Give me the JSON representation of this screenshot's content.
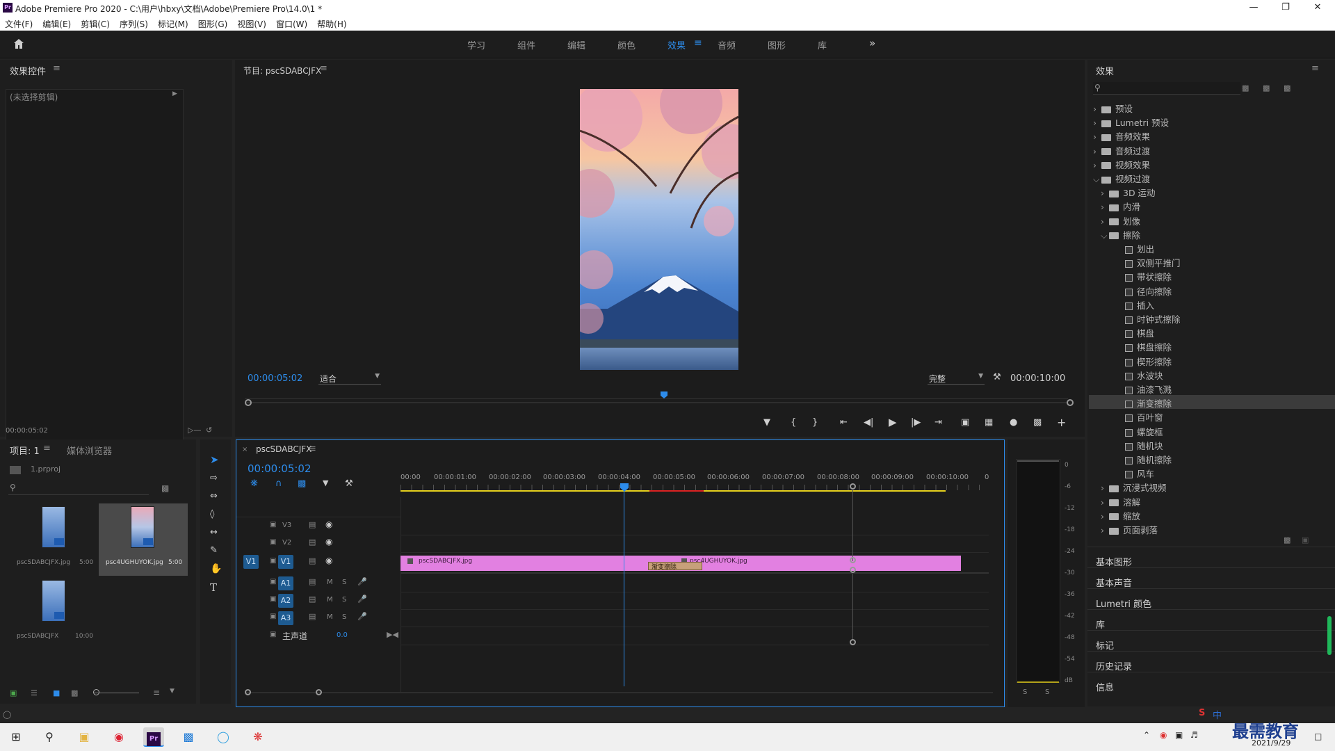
{
  "titlebar": {
    "app_badge": "Pr",
    "title": "Adobe Premiere Pro 2020 - C:\\用户\\hbxy\\文档\\Adobe\\Premiere Pro\\14.0\\1 *"
  },
  "menubar": [
    "文件(F)",
    "编辑(E)",
    "剪辑(C)",
    "序列(S)",
    "标记(M)",
    "图形(G)",
    "视图(V)",
    "窗口(W)",
    "帮助(H)"
  ],
  "workspaces": {
    "tabs": [
      "学习",
      "组件",
      "编辑",
      "颜色",
      "效果",
      "音频",
      "图形",
      "库"
    ],
    "active": "效果"
  },
  "effect_controls": {
    "title": "效果控件",
    "no_clip": "(未选择剪辑)",
    "timecode": "00:00:05:02"
  },
  "program_monitor": {
    "title": "节目: pscSDABCJFX",
    "timecode": "00:00:05:02",
    "fit": "适合",
    "quality": "完整",
    "duration": "00:00:10:00"
  },
  "project": {
    "tab_project": "项目: 1",
    "tab_media": "媒体浏览器",
    "file": "1.prproj",
    "items": [
      {
        "name": "pscSDABCJFX.jpg",
        "duration": "5:00"
      },
      {
        "name": "psc4UGHUYOK.jpg",
        "duration": "5:00"
      },
      {
        "name": "pscSDABCJFX",
        "duration": "10:00"
      }
    ]
  },
  "timeline": {
    "tab": "pscSDABCJFX",
    "timecode": "00:00:05:02",
    "ruler": [
      "00:00",
      "00:00:01:00",
      "00:00:02:00",
      "00:00:03:00",
      "00:00:04:00",
      "00:00:05:00",
      "00:00:06:00",
      "00:00:07:00",
      "00:00:08:00",
      "00:00:09:00",
      "00:00:10:00",
      "0"
    ],
    "tracks": {
      "v3": "V3",
      "v2": "V2",
      "v1": "V1",
      "v1_src": "V1",
      "a1": "A1",
      "a2": "A2",
      "a3": "A3",
      "m": "M",
      "s": "S",
      "master": "主声道",
      "master_val": "0.0"
    },
    "clip1": "pscSDABCJFX.jpg",
    "clip2": "psc4UGHUYOK.jpg",
    "transition": "渐变擦除"
  },
  "audio_meter": {
    "scale": [
      "0",
      "-6",
      "-12",
      "-18",
      "-24",
      "-30",
      "-36",
      "-42",
      "-48",
      "-54",
      "dB"
    ],
    "solo": [
      "S",
      "S"
    ]
  },
  "effects_panel": {
    "title": "效果",
    "tree": [
      {
        "label": "预设",
        "depth": 0,
        "kind": "folder",
        "open": false
      },
      {
        "label": "Lumetri 预设",
        "depth": 0,
        "kind": "folder",
        "open": false
      },
      {
        "label": "音频效果",
        "depth": 0,
        "kind": "folder",
        "open": false
      },
      {
        "label": "音频过渡",
        "depth": 0,
        "kind": "folder",
        "open": false
      },
      {
        "label": "视频效果",
        "depth": 0,
        "kind": "folder",
        "open": false
      },
      {
        "label": "视频过渡",
        "depth": 0,
        "kind": "folder",
        "open": true
      },
      {
        "label": "3D 运动",
        "depth": 1,
        "kind": "folder",
        "open": false
      },
      {
        "label": "内滑",
        "depth": 1,
        "kind": "folder",
        "open": false
      },
      {
        "label": "划像",
        "depth": 1,
        "kind": "folder",
        "open": false
      },
      {
        "label": "擦除",
        "depth": 1,
        "kind": "folder",
        "open": true
      },
      {
        "label": "划出",
        "depth": 2,
        "kind": "fx"
      },
      {
        "label": "双侧平推门",
        "depth": 2,
        "kind": "fx"
      },
      {
        "label": "带状擦除",
        "depth": 2,
        "kind": "fx"
      },
      {
        "label": "径向擦除",
        "depth": 2,
        "kind": "fx"
      },
      {
        "label": "插入",
        "depth": 2,
        "kind": "fx"
      },
      {
        "label": "时钟式擦除",
        "depth": 2,
        "kind": "fx"
      },
      {
        "label": "棋盘",
        "depth": 2,
        "kind": "fx"
      },
      {
        "label": "棋盘擦除",
        "depth": 2,
        "kind": "fx"
      },
      {
        "label": "楔形擦除",
        "depth": 2,
        "kind": "fx"
      },
      {
        "label": "水波块",
        "depth": 2,
        "kind": "fx"
      },
      {
        "label": "油漆飞溅",
        "depth": 2,
        "kind": "fx"
      },
      {
        "label": "渐变擦除",
        "depth": 2,
        "kind": "fx",
        "selected": true
      },
      {
        "label": "百叶窗",
        "depth": 2,
        "kind": "fx"
      },
      {
        "label": "螺旋框",
        "depth": 2,
        "kind": "fx"
      },
      {
        "label": "随机块",
        "depth": 2,
        "kind": "fx"
      },
      {
        "label": "随机擦除",
        "depth": 2,
        "kind": "fx"
      },
      {
        "label": "风车",
        "depth": 2,
        "kind": "fx"
      },
      {
        "label": "沉浸式视频",
        "depth": 1,
        "kind": "folder",
        "open": false
      },
      {
        "label": "溶解",
        "depth": 1,
        "kind": "folder",
        "open": false
      },
      {
        "label": "缩放",
        "depth": 1,
        "kind": "folder",
        "open": false
      },
      {
        "label": "页面剥落",
        "depth": 1,
        "kind": "folder",
        "open": false
      }
    ],
    "sections": [
      "基本图形",
      "基本声音",
      "Lumetri 颜色",
      "库",
      "标记",
      "历史记录",
      "信息"
    ]
  },
  "taskbar": {
    "date": "2021/9/29",
    "ime": "中",
    "watermark": "最需教育"
  },
  "colors": {
    "accent": "#2d8ceb",
    "clip": "#e280e1",
    "transition": "#c7a07a",
    "work_area": "#e6d11d"
  }
}
